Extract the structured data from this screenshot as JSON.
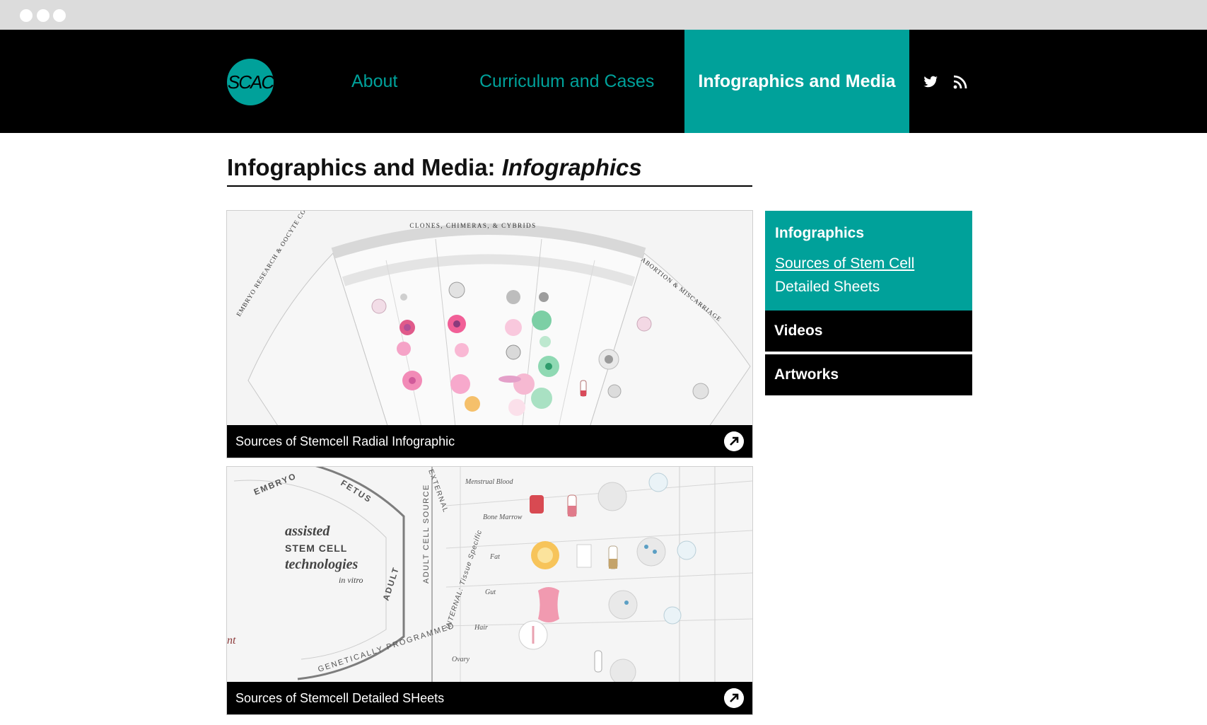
{
  "browser": {
    "window_controls": [
      "close",
      "minimize",
      "maximize"
    ]
  },
  "brand": {
    "logo_text": "SCAC",
    "accent_color": "#00a19a"
  },
  "nav": {
    "items": [
      {
        "label": "About",
        "active": false
      },
      {
        "label": "Curriculum and Cases",
        "active": false
      },
      {
        "label": "Infographics and Media",
        "active": true
      }
    ],
    "social_icons": [
      "twitter-icon",
      "rss-icon"
    ]
  },
  "page": {
    "title_prefix": "Infographics and Media:",
    "title_emphasis": "Infographics"
  },
  "cards": [
    {
      "title": "Sources of Stemcell Radial Infographic",
      "icon": "arrow-up-right-icon"
    },
    {
      "title": "Sources of Stemcell Detailed SHeets",
      "icon": "arrow-up-right-icon"
    }
  ],
  "card1_art": {
    "headings": [
      "CLONES, CHIMERAS, & CYBRIDS",
      "EMBRYO RESEARCH & OOCYTE COMMODITIES",
      "ABORTION & MISCARRIAGE"
    ]
  },
  "card2_art": {
    "ring_labels": [
      "EMBRYO",
      "FETUS",
      "ADULT"
    ],
    "center_lines": [
      "assisted",
      "STEM CELL",
      "technologies",
      "in vitro"
    ],
    "source_labels": [
      "EXTERNAL",
      "ADULT CELL SOURCE",
      "INTERNAL: Tissue Specific",
      "GENETICALLY PROGRAMMED"
    ],
    "tissue_labels": [
      "Menstrual Blood",
      "Bone Marrow",
      "Fat",
      "Gut",
      "Hair",
      "Ovary"
    ]
  },
  "sidebar": {
    "section_title": "Infographics",
    "sub_items": [
      "Sources of Stem Cell",
      "Detailed Sheets"
    ],
    "items": [
      "Videos",
      "Artworks"
    ]
  }
}
